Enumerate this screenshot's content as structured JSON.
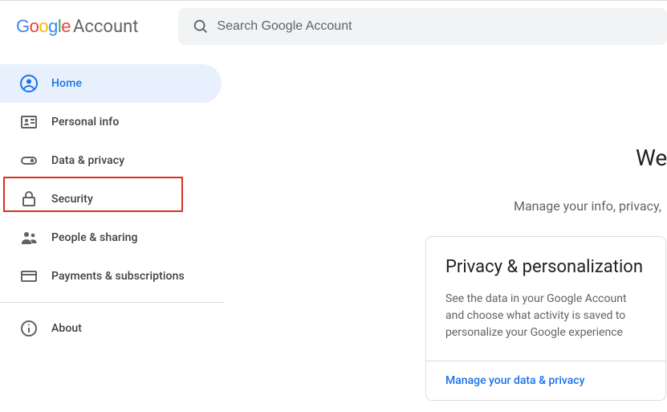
{
  "header": {
    "logo_google": "Google",
    "logo_account": "Account"
  },
  "search": {
    "placeholder": "Search Google Account"
  },
  "sidebar": {
    "items": [
      {
        "label": "Home"
      },
      {
        "label": "Personal info"
      },
      {
        "label": "Data & privacy"
      },
      {
        "label": "Security"
      },
      {
        "label": "People & sharing"
      },
      {
        "label": "Payments & subscriptions"
      }
    ],
    "about": {
      "label": "About"
    }
  },
  "main": {
    "welcome_fragment": "We",
    "subhead_fragment": "Manage your info, privacy,",
    "card": {
      "title": "Privacy & personalization",
      "body": "See the data in your Google Account and choose what activity is saved to personalize your Google experience",
      "link": "Manage your data & privacy"
    }
  }
}
